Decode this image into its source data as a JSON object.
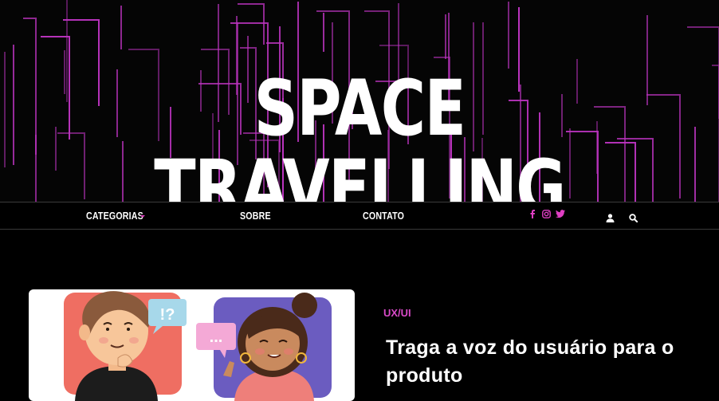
{
  "site": {
    "title": "SPACE TRAVELLING"
  },
  "nav": {
    "categories_label": "CATEGORIAS",
    "about_label": "SOBRE",
    "contact_label": "CONTATO",
    "social_icons": [
      "facebook-icon",
      "instagram-icon",
      "twitter-icon"
    ],
    "utility_icons": [
      "user-icon",
      "search-icon"
    ]
  },
  "featured_post": {
    "category": "UX/UI",
    "title": "Traga a voz do usuário para o produto",
    "image_bubble_left": "!?",
    "image_bubble_right": "..."
  },
  "colors": {
    "accent": "#e03fc4",
    "background": "#000000"
  }
}
